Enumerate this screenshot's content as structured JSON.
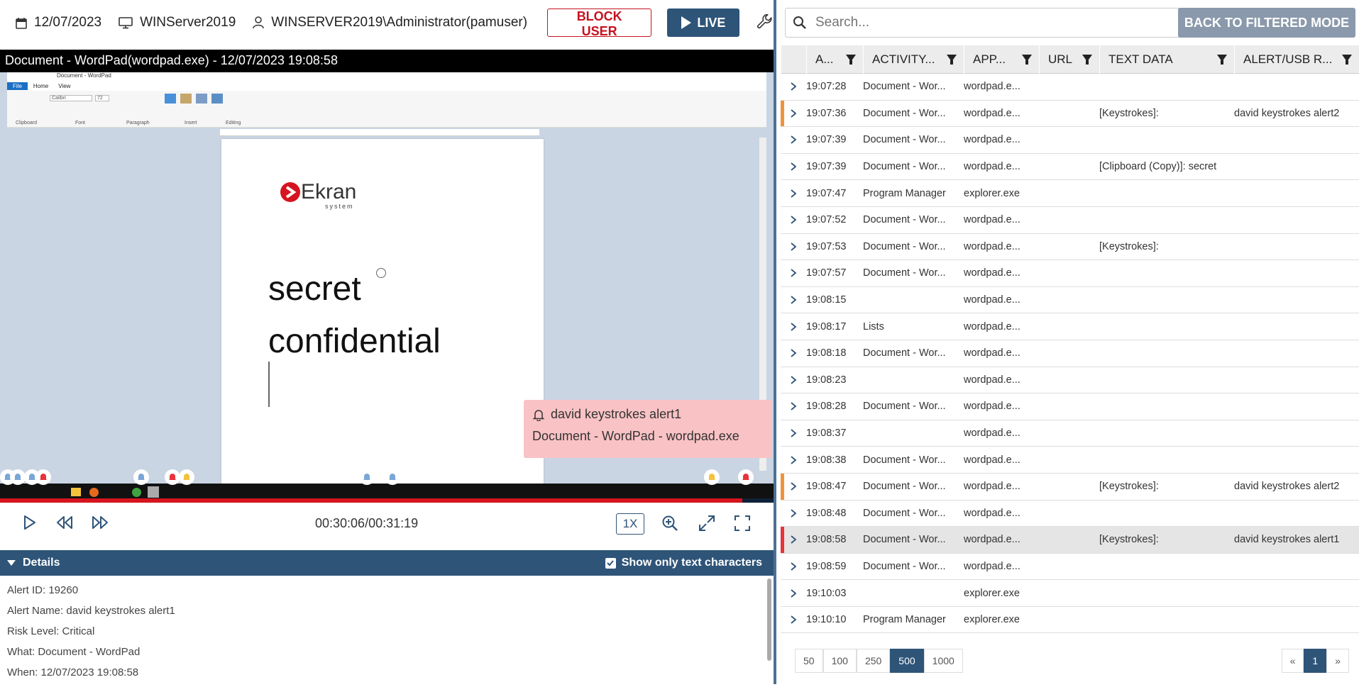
{
  "topbar": {
    "date": "12/07/2023",
    "computer": "WINServer2019",
    "user": "WINSERVER2019\\Administrator(pamuser)",
    "block_label": "BLOCK USER",
    "live_label": "LIVE"
  },
  "player": {
    "title": "Document - WordPad(wordpad.exe) - 12/07/2023 19:08:58",
    "screen": {
      "window_caption": "Document - WordPad",
      "tabs": [
        "File",
        "Home",
        "View"
      ],
      "groups": [
        "Clipboard",
        "Font",
        "Paragraph",
        "Insert",
        "Editing"
      ],
      "font_name": "Calibri",
      "font_size": "72",
      "logo_text": "Ekran",
      "logo_sub": "system",
      "lines": [
        "secret",
        "confidential"
      ]
    },
    "popup": {
      "title": "david keystrokes alert1",
      "subtitle": "Document - WordPad -  wordpad.exe"
    },
    "progress": 0.96,
    "time": "00:30:06/00:31:19",
    "speed": "1X"
  },
  "details": {
    "header": "Details",
    "checkbox_label": "Show only text characters",
    "checked": true,
    "lines": [
      "Alert ID: 19260",
      "Alert Name: david keystrokes alert1",
      "Risk Level: Critical",
      "What: Document - WordPad",
      "When: 12/07/2023 19:08:58"
    ]
  },
  "search": {
    "placeholder": "Search..."
  },
  "back_label": "BACK TO FILTERED MODE",
  "table": {
    "columns": [
      "A...",
      "ACTIVITY...",
      "APP...",
      "URL",
      "TEXT DATA",
      "ALERT/USB R..."
    ],
    "rows": [
      {
        "time": "19:07:28",
        "activity": "Document - Wor...",
        "app": "wordpad.e...",
        "url": "",
        "text": "",
        "alert": "",
        "mark": ""
      },
      {
        "time": "19:07:36",
        "activity": "Document - Wor...",
        "app": "wordpad.e...",
        "url": "",
        "text": "[Keystrokes]:",
        "alert": "david keystrokes alert2",
        "mark": "#f0923a"
      },
      {
        "time": "19:07:39",
        "activity": "Document - Wor...",
        "app": "wordpad.e...",
        "url": "",
        "text": "",
        "alert": "",
        "mark": ""
      },
      {
        "time": "19:07:39",
        "activity": "Document - Wor...",
        "app": "wordpad.e...",
        "url": "",
        "text": "[Clipboard (Copy)]: secret",
        "alert": "",
        "mark": ""
      },
      {
        "time": "19:07:47",
        "activity": "Program Manager",
        "app": "explorer.exe",
        "url": "",
        "text": "",
        "alert": "",
        "mark": ""
      },
      {
        "time": "19:07:52",
        "activity": "Document - Wor...",
        "app": "wordpad.e...",
        "url": "",
        "text": "",
        "alert": "",
        "mark": ""
      },
      {
        "time": "19:07:53",
        "activity": "Document - Wor...",
        "app": "wordpad.e...",
        "url": "",
        "text": "[Keystrokes]:",
        "alert": "",
        "mark": ""
      },
      {
        "time": "19:07:57",
        "activity": "Document - Wor...",
        "app": "wordpad.e...",
        "url": "",
        "text": "",
        "alert": "",
        "mark": ""
      },
      {
        "time": "19:08:15",
        "activity": "",
        "app": "wordpad.e...",
        "url": "",
        "text": "",
        "alert": "",
        "mark": ""
      },
      {
        "time": "19:08:17",
        "activity": "Lists",
        "app": "wordpad.e...",
        "url": "",
        "text": "",
        "alert": "",
        "mark": ""
      },
      {
        "time": "19:08:18",
        "activity": "Document - Wor...",
        "app": "wordpad.e...",
        "url": "",
        "text": "",
        "alert": "",
        "mark": ""
      },
      {
        "time": "19:08:23",
        "activity": "",
        "app": "wordpad.e...",
        "url": "",
        "text": "",
        "alert": "",
        "mark": ""
      },
      {
        "time": "19:08:28",
        "activity": "Document - Wor...",
        "app": "wordpad.e...",
        "url": "",
        "text": "",
        "alert": "",
        "mark": ""
      },
      {
        "time": "19:08:37",
        "activity": "",
        "app": "wordpad.e...",
        "url": "",
        "text": "",
        "alert": "",
        "mark": ""
      },
      {
        "time": "19:08:38",
        "activity": "Document - Wor...",
        "app": "wordpad.e...",
        "url": "",
        "text": "",
        "alert": "",
        "mark": ""
      },
      {
        "time": "19:08:47",
        "activity": "Document - Wor...",
        "app": "wordpad.e...",
        "url": "",
        "text": "[Keystrokes]:",
        "alert": "david keystrokes alert2",
        "mark": "#f0923a"
      },
      {
        "time": "19:08:48",
        "activity": "Document - Wor...",
        "app": "wordpad.e...",
        "url": "",
        "text": "",
        "alert": "",
        "mark": ""
      },
      {
        "time": "19:08:58",
        "activity": "Document - Wor...",
        "app": "wordpad.e...",
        "url": "",
        "text": "[Keystrokes]:",
        "alert": "david keystrokes alert1",
        "mark": "#e8323c",
        "selected": true
      },
      {
        "time": "19:08:59",
        "activity": "Document - Wor...",
        "app": "wordpad.e...",
        "url": "",
        "text": "",
        "alert": "",
        "mark": ""
      },
      {
        "time": "19:10:03",
        "activity": "",
        "app": "explorer.exe",
        "url": "",
        "text": "",
        "alert": "",
        "mark": ""
      },
      {
        "time": "19:10:10",
        "activity": "Program Manager",
        "app": "explorer.exe",
        "url": "",
        "text": "",
        "alert": "",
        "mark": ""
      }
    ]
  },
  "pager": {
    "sizes": [
      "50",
      "100",
      "250",
      "500",
      "1000"
    ],
    "active_size": "500",
    "prev": "«",
    "page": "1",
    "next": "»"
  },
  "colors": {
    "accent": "#2e5478",
    "danger": "#c4121f",
    "warning": "#f0923a"
  }
}
